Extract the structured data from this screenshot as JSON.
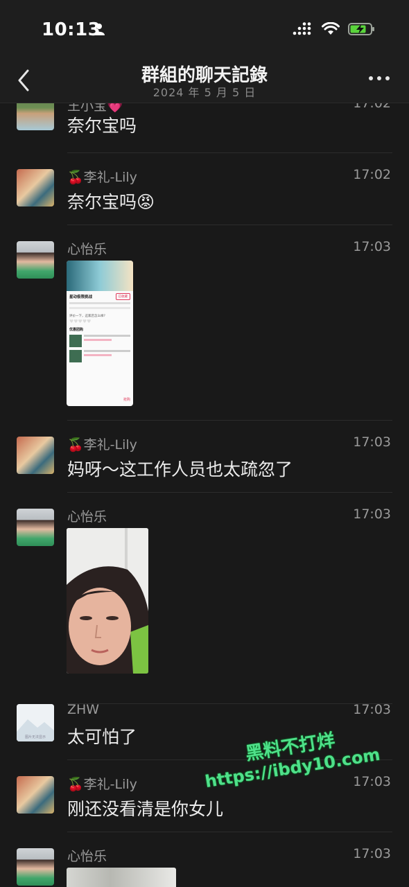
{
  "status_bar": {
    "time": "10:13"
  },
  "header": {
    "title": "群組的聊天記錄",
    "subtitle": "2024 年 5 月 5 日"
  },
  "messages": [
    {
      "sender": "王小宝",
      "sender_emoji": "💗",
      "time": "17:02",
      "text": "奈尔宝吗",
      "text_emoji": ""
    },
    {
      "sender": "李礼-Lily",
      "sender_emoji": "🍒",
      "time": "17:02",
      "text": "奈尔宝吗",
      "text_emoji": "😡"
    },
    {
      "sender": "心怡乐",
      "time": "17:03",
      "image": "app-screenshot",
      "screenshot": {
        "title": "星动极限挑战",
        "button": "已收藏",
        "prompt": "评价一下，这家店怎么样?",
        "section": "优惠团购",
        "buy": "抢购"
      }
    },
    {
      "sender": "李礼-Lily",
      "sender_emoji": "🍒",
      "time": "17:03",
      "text": "妈呀～这工作人员也太疏忽了"
    },
    {
      "sender": "心怡乐",
      "time": "17:03",
      "image": "selfie-photo"
    },
    {
      "sender": "ZHW",
      "time": "17:03",
      "text": "太可怕了",
      "avatar_caption": "图片无法显示"
    },
    {
      "sender": "李礼-Lily",
      "sender_emoji": "🍒",
      "time": "17:03",
      "text": "刚还没看清是你女儿"
    },
    {
      "sender": "心怡乐",
      "time": "17:03",
      "image": "photo"
    }
  ],
  "watermark": {
    "line1": "黑料不打烊",
    "line2": "https://ibdy10.com"
  }
}
